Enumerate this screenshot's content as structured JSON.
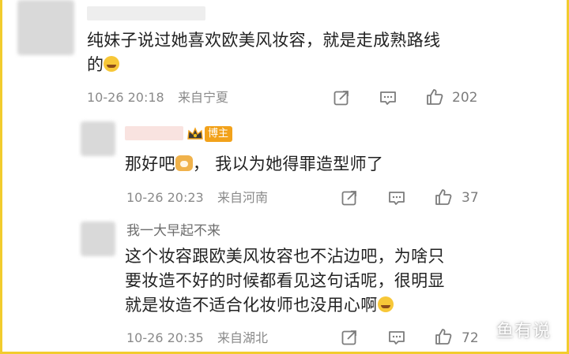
{
  "comments": [
    {
      "text_line1": "纯妹子说过她喜欢欧美风妆容，就是走成熟路线",
      "text_line2": "的",
      "time": "10-26 20:18",
      "location": "来自宁夏",
      "likes": "202",
      "icons": [
        "share-icon",
        "comment-icon",
        "like-icon",
        "laugh-cry-emoji"
      ]
    },
    {
      "badge": "博主",
      "text_part1": "那好吧",
      "text_part2": "，  我以为她得罪造型师了",
      "time": "10-26 20:23",
      "location": "来自河南",
      "likes": "37",
      "icons": [
        "crown-icon",
        "dog-emoji",
        "share-icon",
        "comment-icon",
        "like-icon"
      ]
    },
    {
      "author": "我一大早起不来",
      "text_line1": "这个妆容跟欧美风妆容也不沾边吧，为啥只",
      "text_line2": "要妆造不好的时候都看见这句话呢，很明显",
      "text_line3": "就是妆造不适合化妆师也没用心啊",
      "time": "10-26 20:35",
      "location": "来自湖北",
      "likes": "72",
      "icons": [
        "laugh-cry-emoji",
        "share-icon",
        "comment-icon",
        "like-icon"
      ]
    }
  ],
  "watermark": "鱼有说",
  "colors": {
    "border": "#f2cc2e",
    "badge": "#f2a21b",
    "text": "#222222",
    "meta": "#8a8a8a"
  }
}
